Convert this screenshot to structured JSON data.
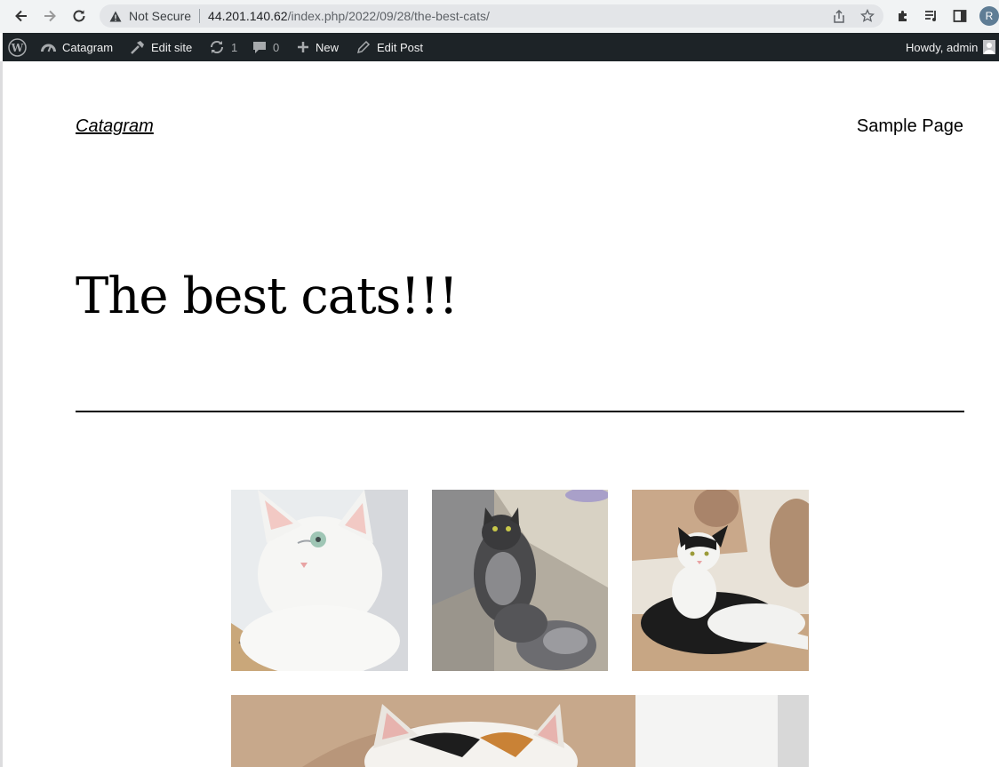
{
  "browser": {
    "security_label": "Not Secure",
    "url_host": "44.201.140.62",
    "url_path": "/index.php/2022/09/28/the-best-cats/",
    "profile_initial": "R"
  },
  "adminbar": {
    "site_name": "Catagram",
    "edit_site": "Edit site",
    "updates_count": "1",
    "comments_count": "0",
    "new_label": "New",
    "edit_post": "Edit Post",
    "howdy": "Howdy, admin"
  },
  "site": {
    "title": "Catagram",
    "nav_item": "Sample Page"
  },
  "post": {
    "title": "The best cats!!!"
  },
  "gallery": {
    "images": [
      {
        "name": "white-cat-photo"
      },
      {
        "name": "grey-fluffy-cat-photo"
      },
      {
        "name": "black-white-cat-photo"
      },
      {
        "name": "calico-cat-photo"
      }
    ]
  },
  "colors": {
    "adminbar_bg": "#1d2327",
    "chrome_bg": "#f1f3f4",
    "text": "#000000"
  }
}
